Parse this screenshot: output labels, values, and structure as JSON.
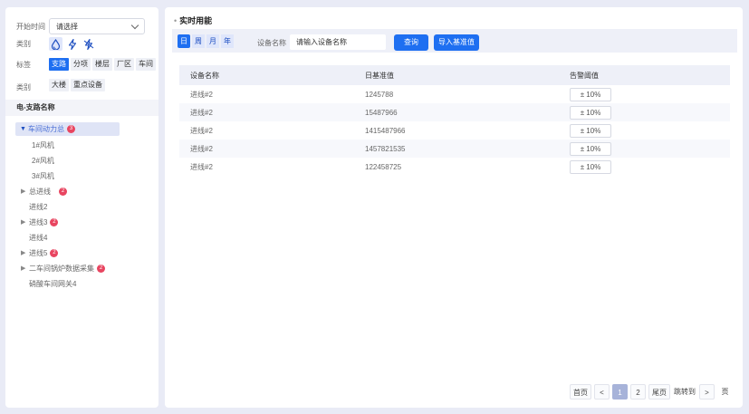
{
  "filters": {
    "start_time_label": "开始时间",
    "start_time_value": "请选择",
    "type_label": "类别",
    "tag_label": "标签",
    "tag_type_label": "类别",
    "tag_chips": [
      "支路",
      "分项",
      "楼层",
      "厂区",
      "车间"
    ],
    "type_chips": [
      "大楼",
      "重点设备"
    ],
    "icons": [
      "water-drop-icon",
      "lightning-icon",
      "no-lightning-icon"
    ]
  },
  "tree": {
    "header": "电-支路名称",
    "items": [
      {
        "label": "车间动力总",
        "badge": "3"
      },
      {
        "label": "1#风机"
      },
      {
        "label": "2#风机"
      },
      {
        "label": "3#风机"
      },
      {
        "label": "总进线",
        "badge": "2"
      },
      {
        "label": "进线2"
      },
      {
        "label": "进线3",
        "badge": "2"
      },
      {
        "label": "进线4"
      },
      {
        "label": "进线5",
        "badge": "2"
      },
      {
        "label": "二车间锅炉数据采集",
        "badge": "2"
      },
      {
        "label": "硝酸车间网关4"
      }
    ]
  },
  "main": {
    "title": "实时用能",
    "periods": [
      "日",
      "周",
      "月",
      "年"
    ],
    "device_label": "设备名称",
    "device_placeholder": "请输入设备名称",
    "query_button": "查询",
    "import_button": "导入基准值",
    "table": {
      "headers": [
        "设备名称",
        "日基准值",
        "告警阈值"
      ],
      "rows": [
        {
          "name": "进线#2",
          "base": "1245788",
          "threshold": "± 10%"
        },
        {
          "name": "进线#2",
          "base": "15487966",
          "threshold": "± 10%"
        },
        {
          "name": "进线#2",
          "base": "1415487966",
          "threshold": "± 10%"
        },
        {
          "name": "进线#2",
          "base": "1457821535",
          "threshold": "± 10%"
        },
        {
          "name": "进线#2",
          "base": "122458725",
          "threshold": "± 10%"
        }
      ]
    }
  },
  "pager": {
    "first": "首页",
    "prev": "<",
    "pages": [
      "1",
      "2"
    ],
    "last": "尾页",
    "jump": "跳转到",
    "next": ">",
    "page_suffix": "页",
    "current": "1"
  },
  "colors": {
    "accent": "#1e6ff1",
    "badge": "#e84560",
    "background": "#e9ebf6"
  }
}
